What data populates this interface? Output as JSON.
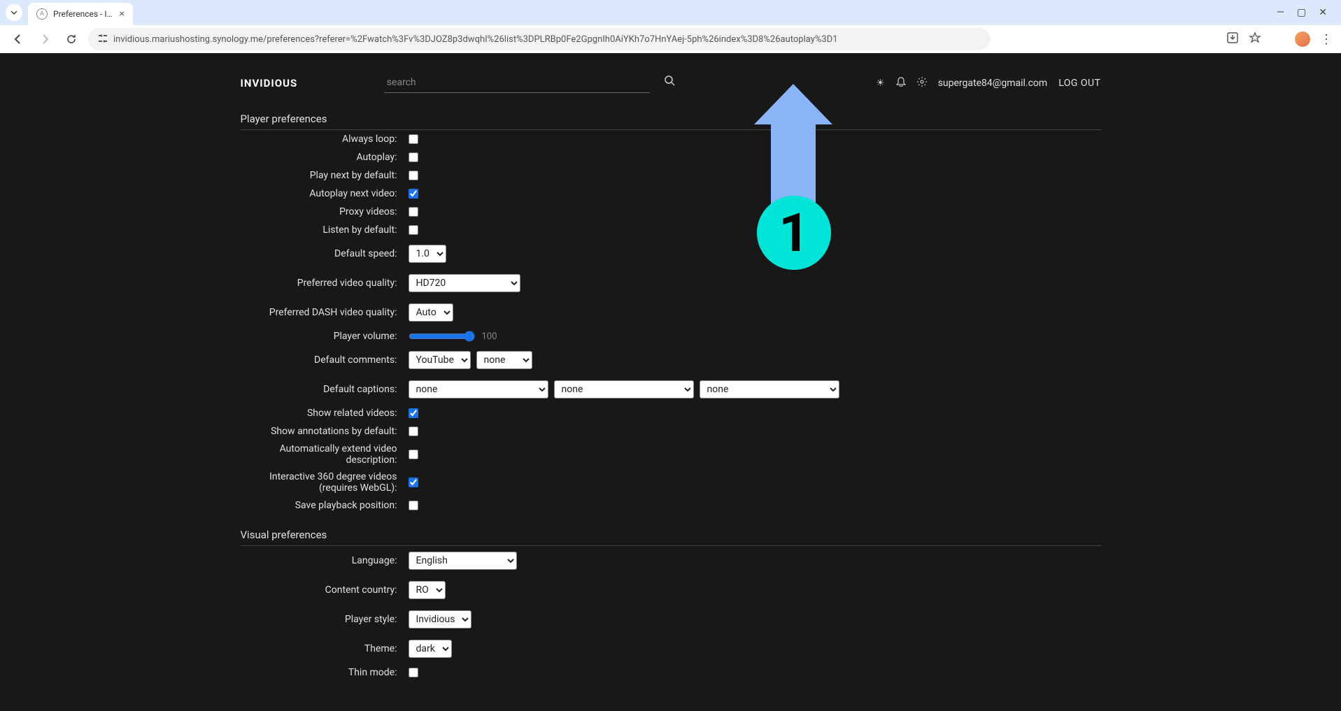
{
  "browser": {
    "tab_title": "Preferences - Invidious",
    "url": "invidious.mariushosting.synology.me/preferences?referer=%2Fwatch%3Fv%3DJOZ8p3dwqhI%26list%3DPLRBp0Fe2GpgnIh0AiYKh7o7HnYAej-5ph%26index%3D8%26autoplay%3D1",
    "window_min": "—",
    "window_max": "▢",
    "window_close": "✕"
  },
  "header": {
    "logo": "INVIDIOUS",
    "search_placeholder": "search",
    "user_email": "supergate84@gmail.com",
    "logout": "LOG OUT"
  },
  "sections": {
    "player": "Player preferences",
    "visual": "Visual preferences"
  },
  "prefs": {
    "always_loop": {
      "label": "Always loop:",
      "checked": false
    },
    "autoplay": {
      "label": "Autoplay:",
      "checked": false
    },
    "play_next": {
      "label": "Play next by default:",
      "checked": false
    },
    "autoplay_next": {
      "label": "Autoplay next video:",
      "checked": true
    },
    "proxy": {
      "label": "Proxy videos:",
      "checked": false
    },
    "listen": {
      "label": "Listen by default:",
      "checked": false
    },
    "speed": {
      "label": "Default speed:",
      "value": "1.0"
    },
    "quality": {
      "label": "Preferred video quality:",
      "value": "HD720"
    },
    "dash_quality": {
      "label": "Preferred DASH video quality:",
      "value": "Auto"
    },
    "volume": {
      "label": "Player volume:",
      "value": "100"
    },
    "comments": {
      "label": "Default comments:",
      "value1": "YouTube",
      "value2": "none"
    },
    "captions": {
      "label": "Default captions:",
      "value1": "none",
      "value2": "none",
      "value3": "none"
    },
    "related": {
      "label": "Show related videos:",
      "checked": true
    },
    "annotations": {
      "label": "Show annotations by default:",
      "checked": false
    },
    "extend_desc": {
      "label": "Automatically extend video description:",
      "checked": false
    },
    "vr360": {
      "label": "Interactive 360 degree videos (requires WebGL):",
      "checked": true
    },
    "save_pos": {
      "label": "Save playback position:",
      "checked": false
    },
    "language": {
      "label": "Language:",
      "value": "English"
    },
    "country": {
      "label": "Content country:",
      "value": "RO"
    },
    "player_style": {
      "label": "Player style:",
      "value": "Invidious"
    },
    "theme": {
      "label": "Theme:",
      "value": "dark"
    },
    "thin": {
      "label": "Thin mode:",
      "checked": false
    }
  },
  "annotation": {
    "num": "1"
  }
}
